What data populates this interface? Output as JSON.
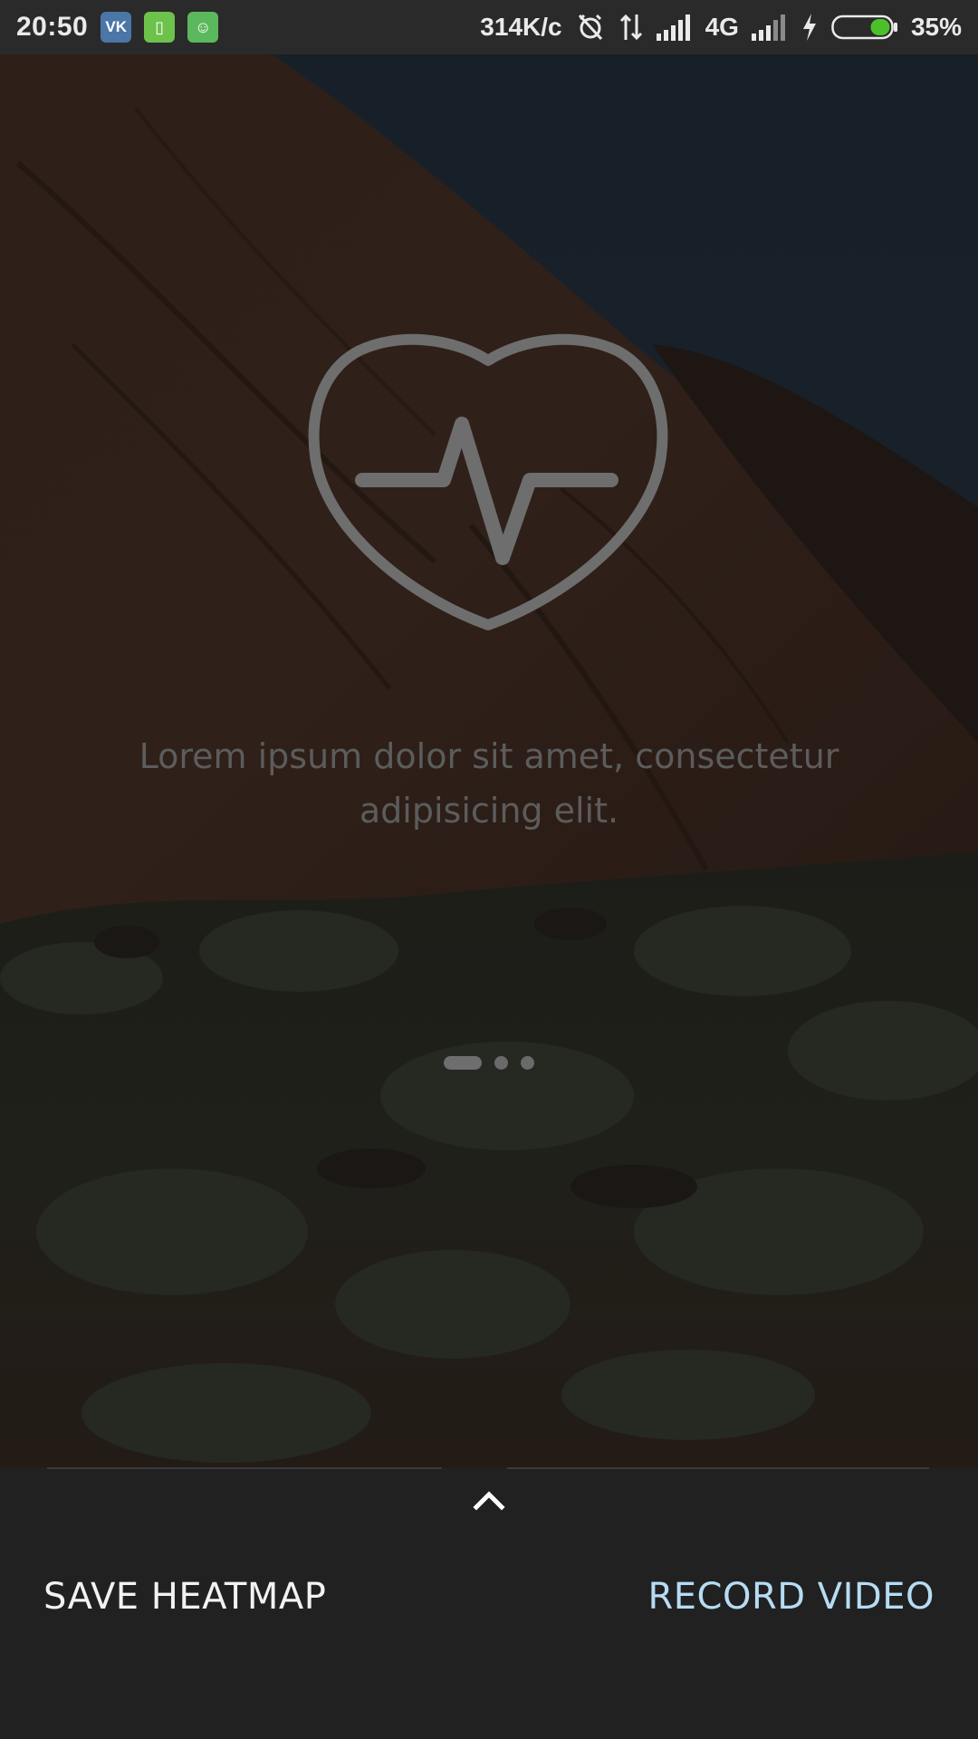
{
  "status_bar": {
    "time": "20:50",
    "apps": [
      {
        "name": "vk",
        "label": "VK"
      },
      {
        "name": "phone",
        "label": "▯"
      },
      {
        "name": "android",
        "label": "☺"
      }
    ],
    "speed": "314K/с",
    "network": "4G",
    "battery_percent": "35%",
    "battery_level": 0.35
  },
  "onboarding": {
    "icon": "heart-pulse-icon",
    "text_line1": "Lorem ipsum dolor sit amet, consectetur",
    "text_line2": "adipisicing elit.",
    "pages_total": 3,
    "current_page": 1
  },
  "bottom_sheet": {
    "handle_icon": "chevron-up-icon",
    "save_label": "SAVE HEATMAP",
    "record_label": "RECORD VIDEO",
    "record_color": "#b6dcf3"
  }
}
